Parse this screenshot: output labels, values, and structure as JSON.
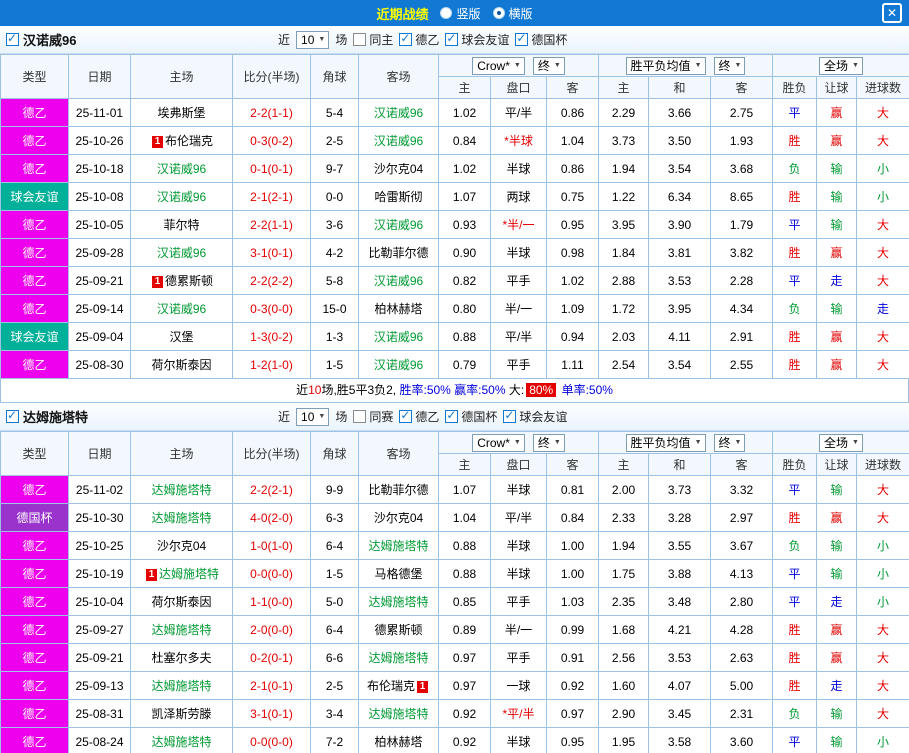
{
  "topbar": {
    "title": "近期战绩",
    "vertical_label": "竖版",
    "horizontal_label": "横版",
    "selected": "横版",
    "close_icon": "✕"
  },
  "controls": {
    "near": "近",
    "matches": "场"
  },
  "table_header": {
    "type": "类型",
    "date": "日期",
    "home": "主场",
    "score": "比分(半场)",
    "corner": "角球",
    "away": "客场",
    "odds_source": "Crow*",
    "final": "终",
    "odds_home": "主",
    "odds_handicap": "盘口",
    "odds_away": "客",
    "avg_label": "胜平负均值",
    "avg_home": "主",
    "avg_draw": "和",
    "avg_away": "客",
    "fullmatch": "全场",
    "res_outcome": "胜负",
    "res_handicap": "让球",
    "res_goals": "进球数"
  },
  "colors": {
    "type": {
      "德乙": "#ee00ee",
      "球会友谊": "#00b098",
      "德国杯": "#9933cc"
    },
    "result": {
      "red": "#e50000",
      "green": "#009933",
      "blue": "#0000dd"
    },
    "focus_team": "#009933",
    "score": "#e50000",
    "badge_bg": "#e50000"
  },
  "sections": [
    {
      "team": "汉诺威96",
      "count": "10",
      "filters": [
        {
          "label": "同主",
          "checked": false
        },
        {
          "label": "德乙",
          "checked": true
        },
        {
          "label": "球会友谊",
          "checked": true
        },
        {
          "label": "德国杯",
          "checked": true
        }
      ],
      "rows": [
        {
          "type": "德乙",
          "date": "25-11-01",
          "home": {
            "name": "埃弗斯堡",
            "focus": false
          },
          "score": "2-2(1-1)",
          "corner": "5-4",
          "away": {
            "name": "汉诺威96",
            "focus": true
          },
          "odds": [
            "1.02",
            "平/半",
            "0.86"
          ],
          "odds_red": false,
          "avg": [
            "2.29",
            "3.66",
            "2.75"
          ],
          "results": [
            [
              "平",
              "blue"
            ],
            [
              "赢",
              "red"
            ],
            [
              "大",
              "red"
            ]
          ]
        },
        {
          "type": "德乙",
          "date": "25-10-26",
          "home": {
            "name": "布伦瑞克",
            "focus": false,
            "badge": {
              "pos": "pre",
              "text": "1"
            }
          },
          "score": "0-3(0-2)",
          "corner": "2-5",
          "away": {
            "name": "汉诺威96",
            "focus": true
          },
          "odds": [
            "0.84",
            "*半球",
            "1.04"
          ],
          "odds_red": true,
          "avg": [
            "3.73",
            "3.50",
            "1.93"
          ],
          "results": [
            [
              "胜",
              "red"
            ],
            [
              "赢",
              "red"
            ],
            [
              "大",
              "red"
            ]
          ]
        },
        {
          "type": "德乙",
          "date": "25-10-18",
          "home": {
            "name": "汉诺威96",
            "focus": true
          },
          "score": "0-1(0-1)",
          "corner": "9-7",
          "away": {
            "name": "沙尔克04",
            "focus": false
          },
          "odds": [
            "1.02",
            "半球",
            "0.86"
          ],
          "odds_red": false,
          "avg": [
            "1.94",
            "3.54",
            "3.68"
          ],
          "results": [
            [
              "负",
              "green"
            ],
            [
              "输",
              "green"
            ],
            [
              "小",
              "green"
            ]
          ]
        },
        {
          "type": "球会友谊",
          "date": "25-10-08",
          "home": {
            "name": "汉诺威96",
            "focus": true
          },
          "score": "2-1(2-1)",
          "corner": "0-0",
          "away": {
            "name": "哈雷斯彻",
            "focus": false
          },
          "odds": [
            "1.07",
            "两球",
            "0.75"
          ],
          "odds_red": false,
          "avg": [
            "1.22",
            "6.34",
            "8.65"
          ],
          "results": [
            [
              "胜",
              "red"
            ],
            [
              "输",
              "green"
            ],
            [
              "小",
              "green"
            ]
          ]
        },
        {
          "type": "德乙",
          "date": "25-10-05",
          "home": {
            "name": "菲尔特",
            "focus": false
          },
          "score": "2-2(1-1)",
          "corner": "3-6",
          "away": {
            "name": "汉诺威96",
            "focus": true
          },
          "odds": [
            "0.93",
            "*半/一",
            "0.95"
          ],
          "odds_red": true,
          "avg": [
            "3.95",
            "3.90",
            "1.79"
          ],
          "results": [
            [
              "平",
              "blue"
            ],
            [
              "输",
              "green"
            ],
            [
              "大",
              "red"
            ]
          ]
        },
        {
          "type": "德乙",
          "date": "25-09-28",
          "home": {
            "name": "汉诺威96",
            "focus": true
          },
          "score": "3-1(0-1)",
          "corner": "4-2",
          "away": {
            "name": "比勒菲尔德",
            "focus": false
          },
          "odds": [
            "0.90",
            "半球",
            "0.98"
          ],
          "odds_red": false,
          "avg": [
            "1.84",
            "3.81",
            "3.82"
          ],
          "results": [
            [
              "胜",
              "red"
            ],
            [
              "赢",
              "red"
            ],
            [
              "大",
              "red"
            ]
          ]
        },
        {
          "type": "德乙",
          "date": "25-09-21",
          "home": {
            "name": "德累斯顿",
            "focus": false,
            "badge": {
              "pos": "pre",
              "text": "1"
            }
          },
          "score": "2-2(2-2)",
          "corner": "5-8",
          "away": {
            "name": "汉诺威96",
            "focus": true
          },
          "odds": [
            "0.82",
            "平手",
            "1.02"
          ],
          "odds_red": false,
          "avg": [
            "2.88",
            "3.53",
            "2.28"
          ],
          "results": [
            [
              "平",
              "blue"
            ],
            [
              "走",
              "blue"
            ],
            [
              "大",
              "red"
            ]
          ]
        },
        {
          "type": "德乙",
          "date": "25-09-14",
          "home": {
            "name": "汉诺威96",
            "focus": true
          },
          "score": "0-3(0-0)",
          "corner": "15-0",
          "away": {
            "name": "柏林赫塔",
            "focus": false
          },
          "odds": [
            "0.80",
            "半/一",
            "1.09"
          ],
          "odds_red": false,
          "avg": [
            "1.72",
            "3.95",
            "4.34"
          ],
          "results": [
            [
              "负",
              "green"
            ],
            [
              "输",
              "green"
            ],
            [
              "走",
              "blue"
            ]
          ]
        },
        {
          "type": "球会友谊",
          "date": "25-09-04",
          "home": {
            "name": "汉堡",
            "focus": false
          },
          "score": "1-3(0-2)",
          "corner": "1-3",
          "away": {
            "name": "汉诺威96",
            "focus": true
          },
          "odds": [
            "0.88",
            "平/半",
            "0.94"
          ],
          "odds_red": false,
          "avg": [
            "2.03",
            "4.11",
            "2.91"
          ],
          "results": [
            [
              "胜",
              "red"
            ],
            [
              "赢",
              "red"
            ],
            [
              "大",
              "red"
            ]
          ]
        },
        {
          "type": "德乙",
          "date": "25-08-30",
          "home": {
            "name": "荷尔斯泰因",
            "focus": false
          },
          "score": "1-2(1-0)",
          "corner": "1-5",
          "away": {
            "name": "汉诺威96",
            "focus": true
          },
          "odds": [
            "0.79",
            "平手",
            "1.11"
          ],
          "odds_red": false,
          "avg": [
            "2.54",
            "3.54",
            "2.55"
          ],
          "results": [
            [
              "胜",
              "red"
            ],
            [
              "赢",
              "red"
            ],
            [
              "大",
              "red"
            ]
          ]
        }
      ],
      "summary": [
        {
          "text": "近",
          "style": "plain"
        },
        {
          "text": "10",
          "style": "red"
        },
        {
          "text": "场,胜5平3负2, ",
          "style": "plain"
        },
        {
          "text": "胜率:50%",
          "style": "blue"
        },
        {
          "text": " 赢率:50%",
          "style": "blue"
        },
        {
          "text": " 大:",
          "style": "plain"
        },
        {
          "text": "80%",
          "style": "badge"
        },
        {
          "text": " 单率:50%",
          "style": "blue"
        }
      ]
    },
    {
      "team": "达姆施塔特",
      "count": "10",
      "filters": [
        {
          "label": "同赛",
          "checked": false
        },
        {
          "label": "德乙",
          "checked": true
        },
        {
          "label": "德国杯",
          "checked": true
        },
        {
          "label": "球会友谊",
          "checked": true
        }
      ],
      "rows": [
        {
          "type": "德乙",
          "date": "25-11-02",
          "home": {
            "name": "达姆施塔特",
            "focus": true
          },
          "score": "2-2(2-1)",
          "corner": "9-9",
          "away": {
            "name": "比勒菲尔德",
            "focus": false
          },
          "odds": [
            "1.07",
            "半球",
            "0.81"
          ],
          "odds_red": false,
          "avg": [
            "2.00",
            "3.73",
            "3.32"
          ],
          "results": [
            [
              "平",
              "blue"
            ],
            [
              "输",
              "green"
            ],
            [
              "大",
              "red"
            ]
          ]
        },
        {
          "type": "德国杯",
          "date": "25-10-30",
          "home": {
            "name": "达姆施塔特",
            "focus": true
          },
          "score": "4-0(2-0)",
          "corner": "6-3",
          "away": {
            "name": "沙尔克04",
            "focus": false
          },
          "odds": [
            "1.04",
            "平/半",
            "0.84"
          ],
          "odds_red": false,
          "avg": [
            "2.33",
            "3.28",
            "2.97"
          ],
          "results": [
            [
              "胜",
              "red"
            ],
            [
              "赢",
              "red"
            ],
            [
              "大",
              "red"
            ]
          ]
        },
        {
          "type": "德乙",
          "date": "25-10-25",
          "home": {
            "name": "沙尔克04",
            "focus": false
          },
          "score": "1-0(1-0)",
          "corner": "6-4",
          "away": {
            "name": "达姆施塔特",
            "focus": true
          },
          "odds": [
            "0.88",
            "半球",
            "1.00"
          ],
          "odds_red": false,
          "avg": [
            "1.94",
            "3.55",
            "3.67"
          ],
          "results": [
            [
              "负",
              "green"
            ],
            [
              "输",
              "green"
            ],
            [
              "小",
              "green"
            ]
          ]
        },
        {
          "type": "德乙",
          "date": "25-10-19",
          "home": {
            "name": "达姆施塔特",
            "focus": true,
            "badge": {
              "pos": "pre",
              "text": "1"
            }
          },
          "score": "0-0(0-0)",
          "corner": "1-5",
          "away": {
            "name": "马格德堡",
            "focus": false
          },
          "odds": [
            "0.88",
            "半球",
            "1.00"
          ],
          "odds_red": false,
          "avg": [
            "1.75",
            "3.88",
            "4.13"
          ],
          "results": [
            [
              "平",
              "blue"
            ],
            [
              "输",
              "green"
            ],
            [
              "小",
              "green"
            ]
          ]
        },
        {
          "type": "德乙",
          "date": "25-10-04",
          "home": {
            "name": "荷尔斯泰因",
            "focus": false
          },
          "score": "1-1(0-0)",
          "corner": "5-0",
          "away": {
            "name": "达姆施塔特",
            "focus": true
          },
          "odds": [
            "0.85",
            "平手",
            "1.03"
          ],
          "odds_red": false,
          "avg": [
            "2.35",
            "3.48",
            "2.80"
          ],
          "results": [
            [
              "平",
              "blue"
            ],
            [
              "走",
              "blue"
            ],
            [
              "小",
              "green"
            ]
          ]
        },
        {
          "type": "德乙",
          "date": "25-09-27",
          "home": {
            "name": "达姆施塔特",
            "focus": true
          },
          "score": "2-0(0-0)",
          "corner": "6-4",
          "away": {
            "name": "德累斯顿",
            "focus": false
          },
          "odds": [
            "0.89",
            "半/一",
            "0.99"
          ],
          "odds_red": false,
          "avg": [
            "1.68",
            "4.21",
            "4.28"
          ],
          "results": [
            [
              "胜",
              "red"
            ],
            [
              "赢",
              "red"
            ],
            [
              "大",
              "red"
            ]
          ]
        },
        {
          "type": "德乙",
          "date": "25-09-21",
          "home": {
            "name": "杜塞尔多夫",
            "focus": false
          },
          "score": "0-2(0-1)",
          "corner": "6-6",
          "away": {
            "name": "达姆施塔特",
            "focus": true
          },
          "odds": [
            "0.97",
            "平手",
            "0.91"
          ],
          "odds_red": false,
          "avg": [
            "2.56",
            "3.53",
            "2.63"
          ],
          "results": [
            [
              "胜",
              "red"
            ],
            [
              "赢",
              "red"
            ],
            [
              "大",
              "red"
            ]
          ]
        },
        {
          "type": "德乙",
          "date": "25-09-13",
          "home": {
            "name": "达姆施塔特",
            "focus": true
          },
          "score": "2-1(0-1)",
          "corner": "2-5",
          "away": {
            "name": "布伦瑞克",
            "focus": false,
            "badge": {
              "pos": "post",
              "text": "1"
            }
          },
          "odds": [
            "0.97",
            "一球",
            "0.92"
          ],
          "odds_red": false,
          "avg": [
            "1.60",
            "4.07",
            "5.00"
          ],
          "results": [
            [
              "胜",
              "red"
            ],
            [
              "走",
              "blue"
            ],
            [
              "大",
              "red"
            ]
          ]
        },
        {
          "type": "德乙",
          "date": "25-08-31",
          "home": {
            "name": "凯泽斯劳滕",
            "focus": false
          },
          "score": "3-1(0-1)",
          "corner": "3-4",
          "away": {
            "name": "达姆施塔特",
            "focus": true
          },
          "odds": [
            "0.92",
            "*平/半",
            "0.97"
          ],
          "odds_red": true,
          "avg": [
            "2.90",
            "3.45",
            "2.31"
          ],
          "results": [
            [
              "负",
              "green"
            ],
            [
              "输",
              "green"
            ],
            [
              "大",
              "red"
            ]
          ]
        },
        {
          "type": "德乙",
          "date": "25-08-24",
          "home": {
            "name": "达姆施塔特",
            "focus": true
          },
          "score": "0-0(0-0)",
          "corner": "7-2",
          "away": {
            "name": "柏林赫塔",
            "focus": false
          },
          "odds": [
            "0.92",
            "半球",
            "0.95"
          ],
          "odds_red": false,
          "avg": [
            "1.95",
            "3.58",
            "3.60"
          ],
          "results": [
            [
              "平",
              "blue"
            ],
            [
              "输",
              "green"
            ],
            [
              "小",
              "green"
            ]
          ]
        }
      ]
    }
  ]
}
